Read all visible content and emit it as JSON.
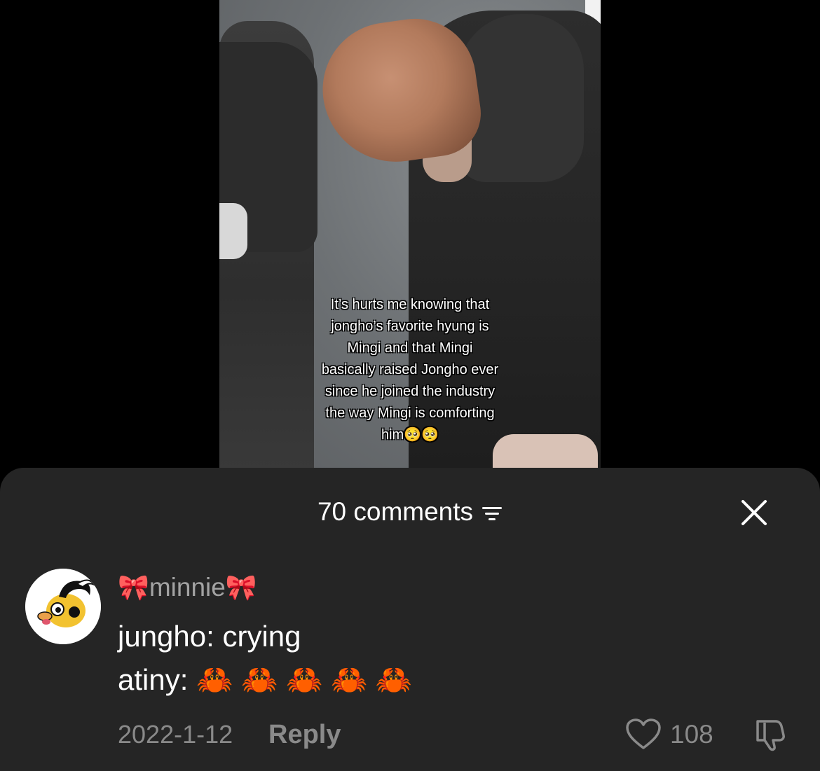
{
  "video": {
    "caption": "It’s hurts me knowing that\njongho’s favorite hyung is\nMingi and that Mingi\nbasically raised Jongho ever\nsince he joined the industry\nthe way Mingi is comforting\nhim🥺🥺"
  },
  "comments_sheet": {
    "title": "70 comments",
    "filter_icon": "filter-icon",
    "close_icon": "close-icon"
  },
  "comment": {
    "username_prefix": "🎀",
    "username": "minnie",
    "username_suffix": "🎀",
    "text": "jungho: crying\natiny: 🦀 🦀 🦀 🦀 🦀",
    "date": "2022-1-12",
    "reply_label": "Reply",
    "likes": "108",
    "like_icon": "heart-icon",
    "dislike_icon": "thumbs-down-icon"
  }
}
